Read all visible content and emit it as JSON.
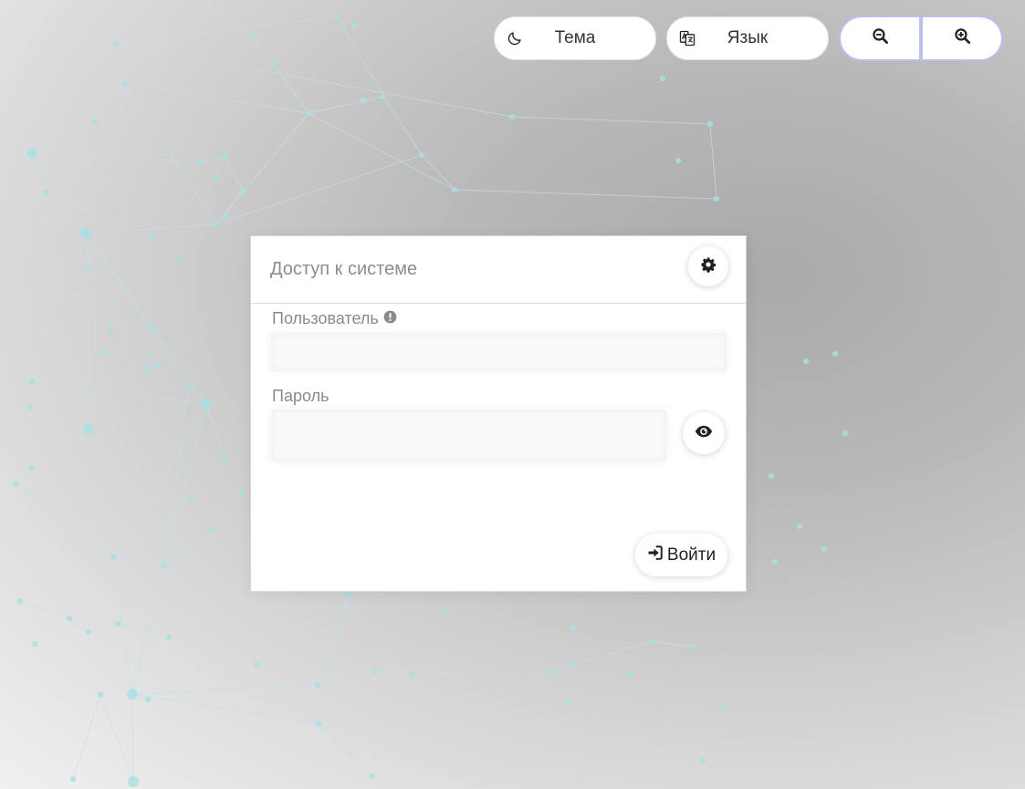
{
  "header": {
    "theme_label": "Тема",
    "language_label": "Язык"
  },
  "icons": {
    "theme": "moon-icon",
    "language": "translate-icon",
    "zoom_out": "zoom-out-icon",
    "zoom_in": "zoom-in-icon",
    "settings": "gear-icon",
    "user_info": "exclamation-circle-icon",
    "show_password": "eye-icon",
    "login": "sign-in-icon"
  },
  "login": {
    "title": "Доступ к системе",
    "username_label": "Пользователь",
    "username_value": "",
    "password_label": "Пароль",
    "password_value": "",
    "submit_label": "Войти"
  },
  "colors": {
    "zoom_border": "#b9bff3",
    "network_line": "#bfe3e6",
    "network_node": "#a9dfe4"
  }
}
